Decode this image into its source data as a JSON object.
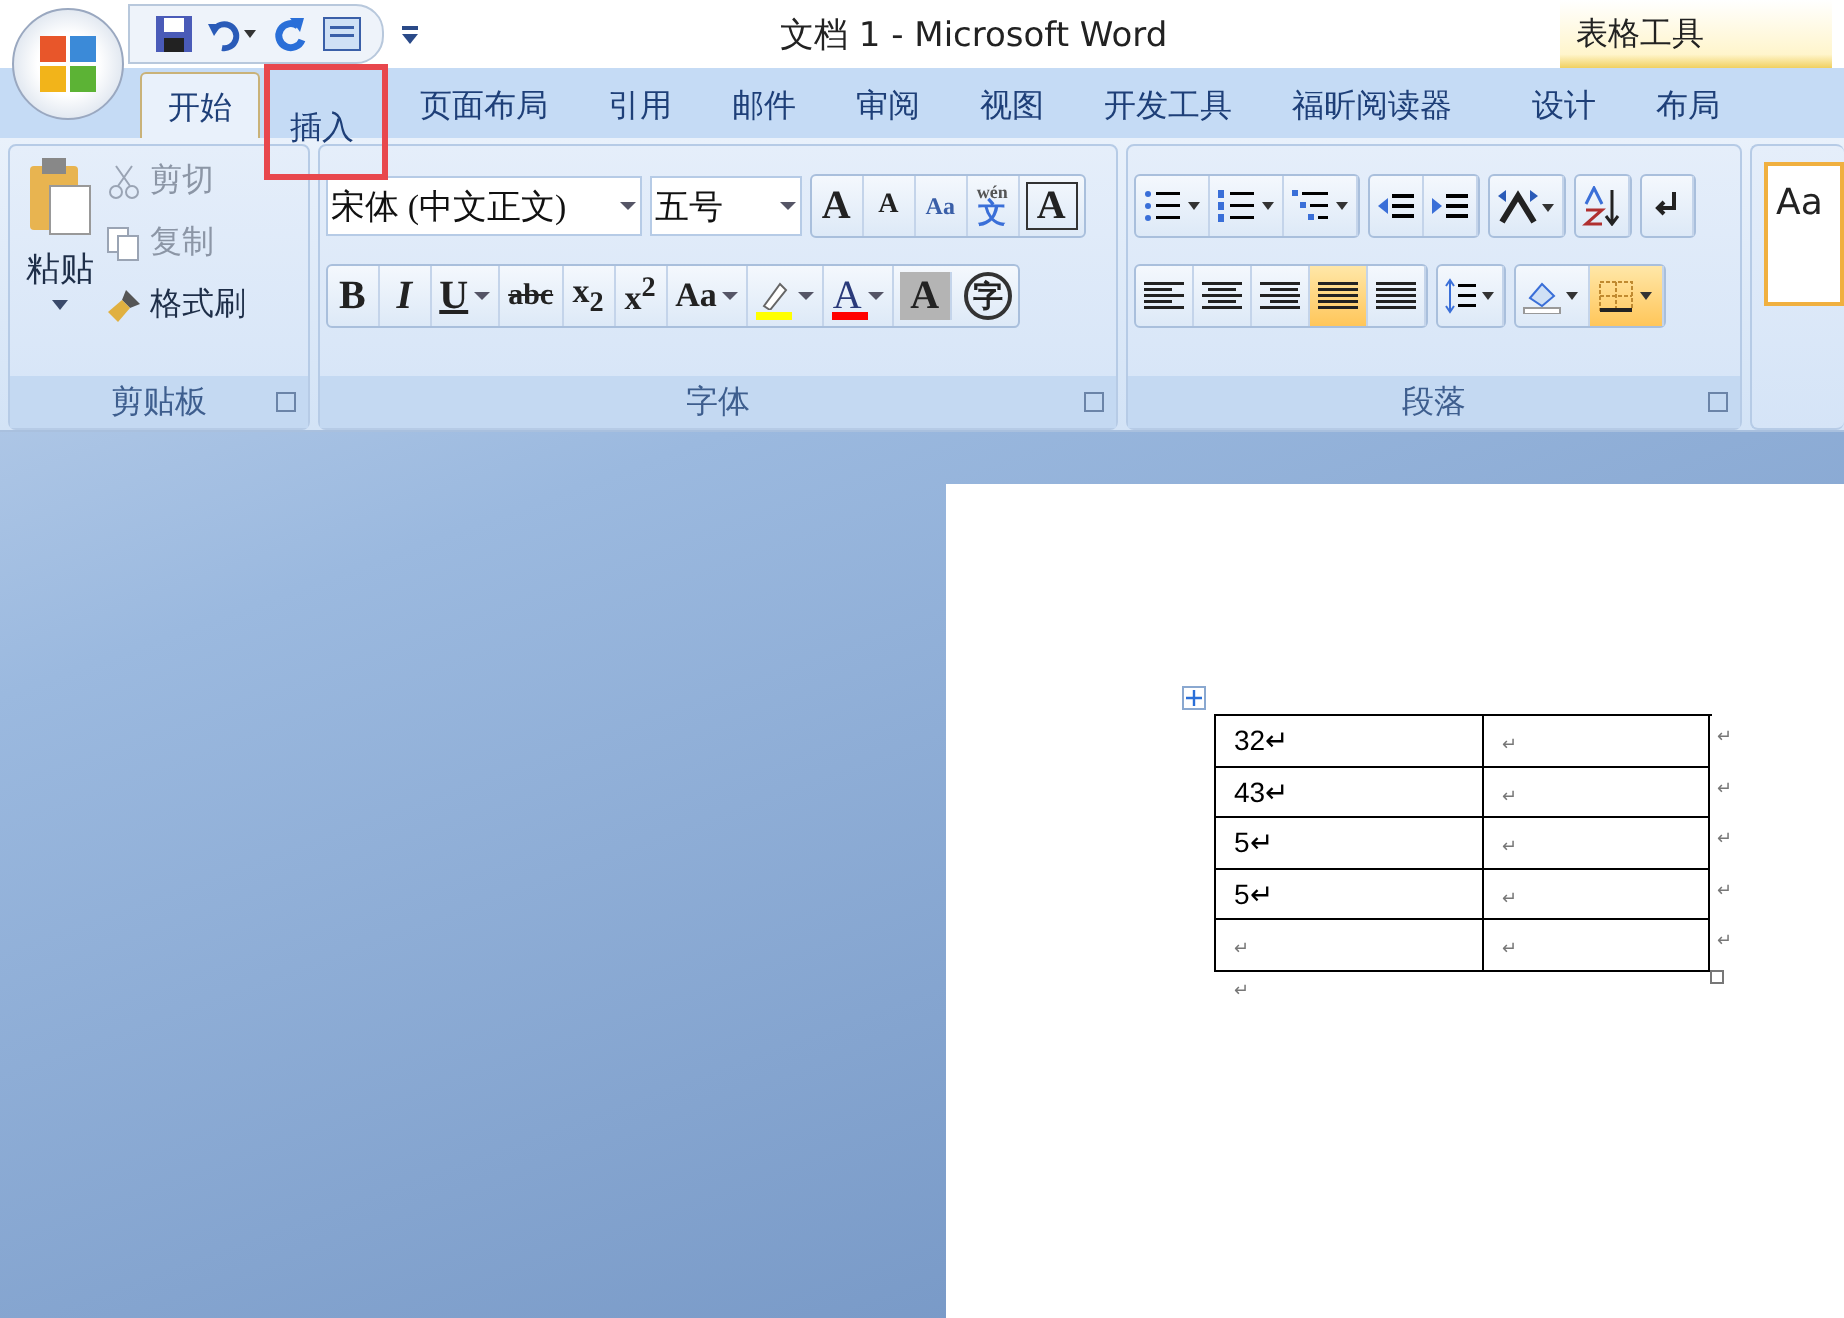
{
  "window": {
    "title": "文档 1 - Microsoft Word"
  },
  "contextual": {
    "header": "表格工具",
    "tabs": [
      {
        "label": "设计",
        "selected": false
      },
      {
        "label": "布局",
        "selected": false
      }
    ]
  },
  "tabs": [
    {
      "label": "开始",
      "selected": true,
      "highlighted": false
    },
    {
      "label": "插入",
      "selected": false,
      "highlighted": true
    },
    {
      "label": "页面布局",
      "selected": false,
      "highlighted": false
    },
    {
      "label": "引用",
      "selected": false,
      "highlighted": false
    },
    {
      "label": "邮件",
      "selected": false,
      "highlighted": false
    },
    {
      "label": "审阅",
      "selected": false,
      "highlighted": false
    },
    {
      "label": "视图",
      "selected": false,
      "highlighted": false
    },
    {
      "label": "开发工具",
      "selected": false,
      "highlighted": false
    },
    {
      "label": "福昕阅读器",
      "selected": false,
      "highlighted": false
    }
  ],
  "clipboard": {
    "paste": "粘贴",
    "group_label": "剪贴板",
    "items": [
      {
        "label": "剪切",
        "disabled": true
      },
      {
        "label": "复制",
        "disabled": true
      },
      {
        "label": "格式刷",
        "disabled": false
      }
    ]
  },
  "font": {
    "font_name": "宋体 (中文正文)",
    "font_size": "五号",
    "group_label": "字体",
    "row1": [
      {
        "kind": "grow",
        "label": "A"
      },
      {
        "kind": "shrink",
        "label": "A"
      },
      {
        "kind": "clear",
        "label": "Aa"
      },
      {
        "kind": "phonetic",
        "label": "wén",
        "sub": "文"
      },
      {
        "kind": "border",
        "label": "A"
      }
    ],
    "row2": [
      {
        "kind": "bold",
        "label": "B",
        "dropdown": false
      },
      {
        "kind": "italic",
        "label": "I",
        "dropdown": false
      },
      {
        "kind": "underline",
        "label": "U",
        "dropdown": true
      },
      {
        "kind": "strike",
        "label": "abc",
        "dropdown": false
      },
      {
        "kind": "rich",
        "label": "x$_{2}$",
        "dropdown": false
      },
      {
        "kind": "rich",
        "label": "x$^{2}$",
        "dropdown": false
      },
      {
        "kind": "case",
        "label": "Aa",
        "dropdown": true
      },
      {
        "kind": "highlight",
        "color": "#ffff00",
        "dropdown": true
      },
      {
        "kind": "color",
        "label": "A",
        "color": "#ff0000",
        "dropdown": true
      },
      {
        "kind": "shaded",
        "label": "A",
        "dropdown": false
      },
      {
        "kind": "circled",
        "label": "字",
        "dropdown": false
      }
    ]
  },
  "paragraph": {
    "group_label": "段落",
    "align": [
      {
        "selected": false
      },
      {
        "selected": false
      },
      {
        "selected": false
      },
      {
        "selected": true
      },
      {
        "selected": false
      }
    ],
    "borders_selected": true
  },
  "styles": {
    "preview": "Aa"
  },
  "table": {
    "rows": [
      {
        "cells": [
          "32↵",
          "↵"
        ],
        "end": "↵"
      },
      {
        "cells": [
          "43↵",
          "↵"
        ],
        "end": "↵"
      },
      {
        "cells": [
          "5↵",
          "↵"
        ],
        "end": "↵"
      },
      {
        "cells": [
          "5↵",
          "↵"
        ],
        "end": "↵"
      },
      {
        "cells": [
          "↵",
          "↵"
        ],
        "end": "↵"
      }
    ]
  },
  "after_table": "↵"
}
